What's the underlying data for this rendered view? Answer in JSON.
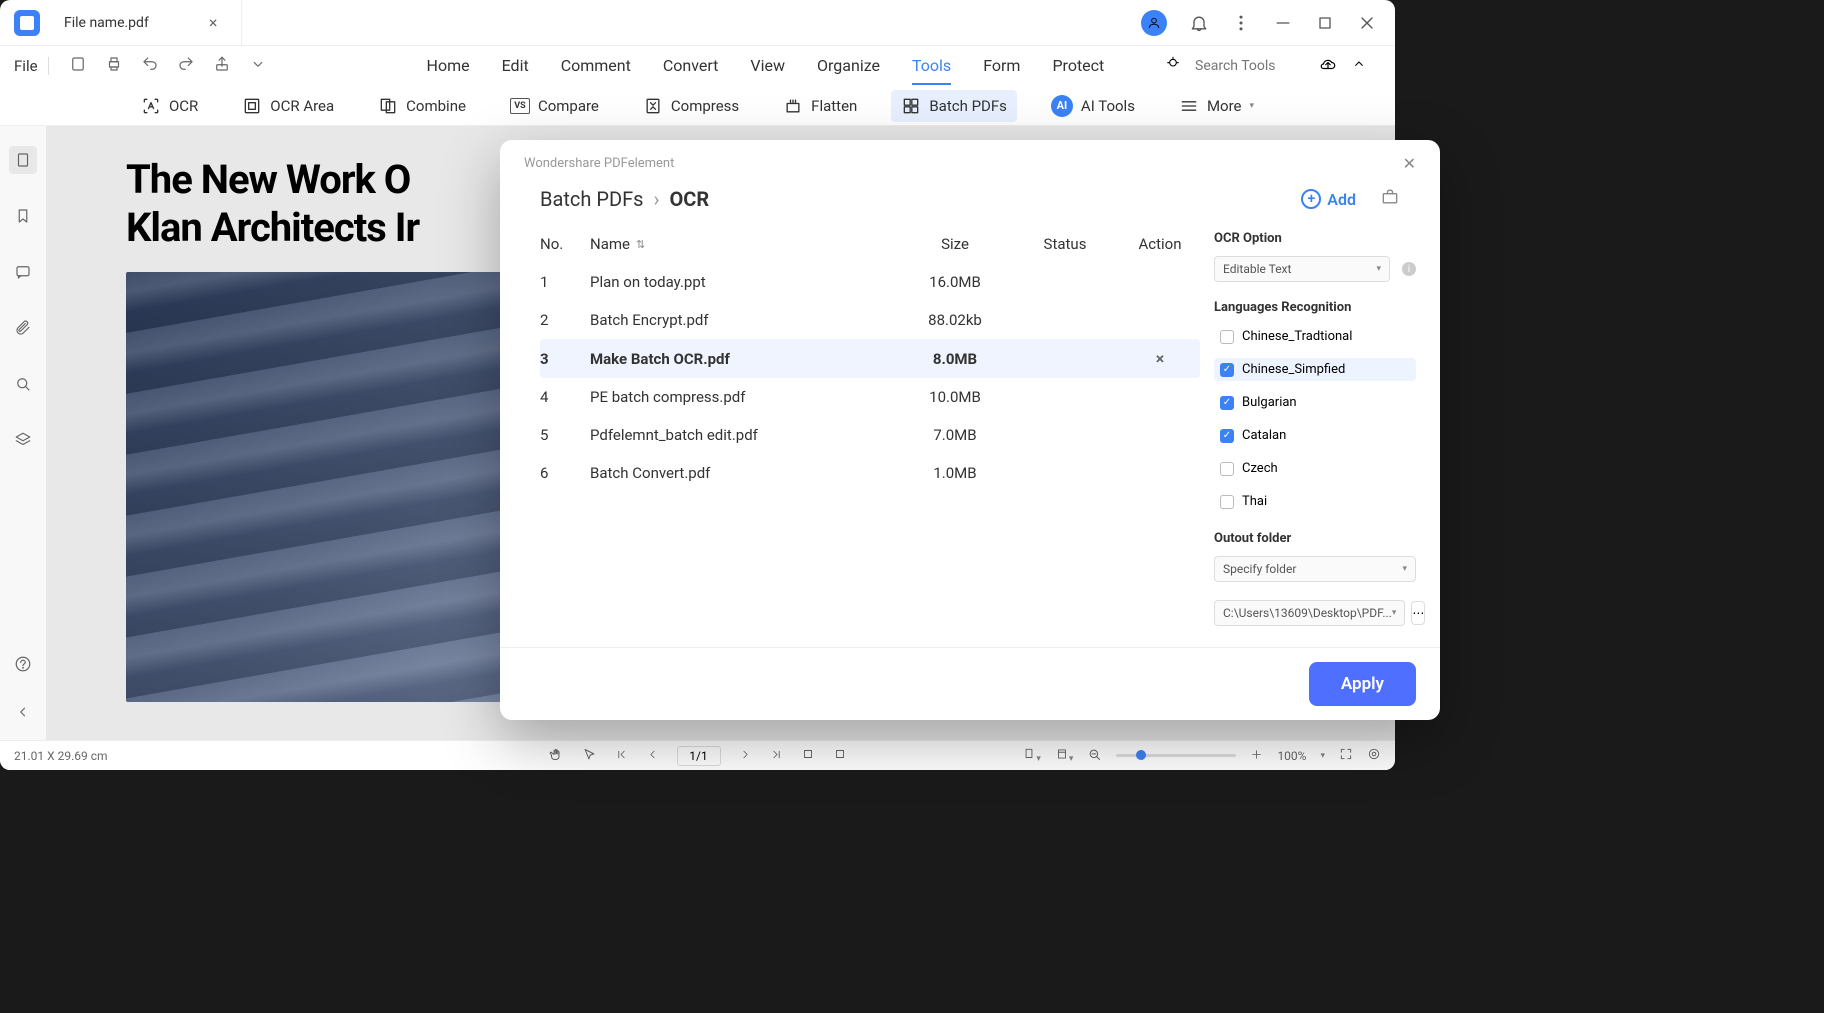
{
  "titlebar": {
    "tab_name": "File name.pdf"
  },
  "menu": {
    "file": "File"
  },
  "tabs": {
    "home": "Home",
    "edit": "Edit",
    "comment": "Comment",
    "convert": "Convert",
    "view": "View",
    "organize": "Organize",
    "tools": "Tools",
    "form": "Form",
    "protect": "Protect"
  },
  "search": {
    "placeholder": "Search Tools"
  },
  "toolbar": {
    "ocr": "OCR",
    "ocr_area": "OCR Area",
    "combine": "Combine",
    "compare": "Compare",
    "compress": "Compress",
    "flatten": "Flatten",
    "batch_pdfs": "Batch PDFs",
    "ai_tools": "AI Tools",
    "more": "More",
    "ai_badge": "AI",
    "vs_badge": "VS"
  },
  "document": {
    "title_line1": "The New Work O",
    "title_line2": "Klan Architects Ir"
  },
  "statusbar": {
    "dimensions": "21.01 X 29.69 cm",
    "page": "1/1",
    "zoom": "100%"
  },
  "dialog": {
    "app_title": "Wondershare PDFelement",
    "breadcrumb_root": "Batch PDFs",
    "breadcrumb_current": "OCR",
    "add_label": "Add",
    "columns": {
      "no": "No.",
      "name": "Name",
      "size": "Size",
      "status": "Status",
      "action": "Action"
    },
    "files": [
      {
        "no": "1",
        "name": "Plan on today.ppt",
        "size": "16.0MB"
      },
      {
        "no": "2",
        "name": "Batch Encrypt.pdf",
        "size": "88.02kb"
      },
      {
        "no": "3",
        "name": "Make Batch OCR.pdf",
        "size": "8.0MB",
        "selected": true
      },
      {
        "no": "4",
        "name": "PE batch compress.pdf",
        "size": "10.0MB"
      },
      {
        "no": "5",
        "name": "Pdfelemnt_batch edit.pdf",
        "size": "7.0MB"
      },
      {
        "no": "6",
        "name": "Batch Convert.pdf",
        "size": "1.0MB"
      }
    ],
    "ocr_option_label": "OCR Option",
    "ocr_option_value": "Editable Text",
    "languages_label": "Languages Recognition",
    "languages": [
      {
        "name": "Chinese_Tradtional",
        "checked": false
      },
      {
        "name": "Chinese_Simpfied",
        "checked": true,
        "selected": true
      },
      {
        "name": "Bulgarian",
        "checked": true
      },
      {
        "name": "Catalan",
        "checked": true
      },
      {
        "name": "Czech",
        "checked": false
      },
      {
        "name": "Thai",
        "checked": false
      }
    ],
    "output_label": "Outout folder",
    "output_mode": "Specify folder",
    "output_path": "C:\\Users\\13609\\Desktop\\PDF...",
    "apply": "Apply"
  }
}
